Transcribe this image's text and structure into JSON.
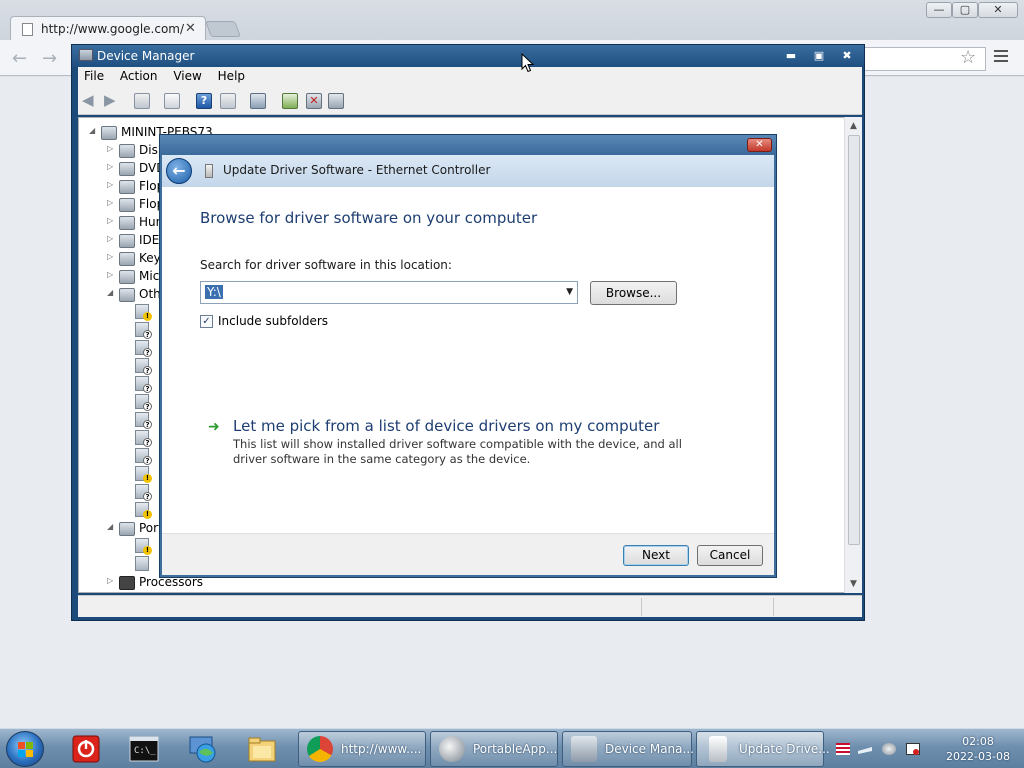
{
  "browser": {
    "tab_title": "http://www.google.com/",
    "tab_close": "✕",
    "controls": {
      "minimize": "—",
      "maximize": "▢",
      "close": "✕"
    },
    "back": "←",
    "forward": "→",
    "star": "☆"
  },
  "device_manager": {
    "title": "Device Manager",
    "controls": {
      "minimize": "▬",
      "maximize": "▣",
      "close": "✖"
    },
    "menu": [
      "File",
      "Action",
      "View",
      "Help"
    ],
    "tree": {
      "root": "MININT-PEBS73",
      "categories": [
        "Disk",
        "DVD",
        "Flop",
        "Flop",
        "Hun",
        "IDE",
        "Key",
        "Mic",
        "Oth"
      ],
      "ports_label": "Port",
      "processors_label": "Processors"
    }
  },
  "dialog": {
    "close": "✕",
    "back": "←",
    "header_title": "Update Driver Software - Ethernet Controller",
    "heading": "Browse for driver software on your computer",
    "search_label": "Search for driver software in this location:",
    "path_value": "Y:\\",
    "browse_label": "Browse...",
    "include_subfolders_label": "Include subfolders",
    "include_subfolders_checked": "✓",
    "pick_arrow": "➜",
    "pick_link": "Let me pick from a list of device drivers on my computer",
    "pick_description": "This list will show installed driver software compatible with the device, and all driver software in the same category as the device.",
    "next_label": "Next",
    "cancel_label": "Cancel"
  },
  "taskbar": {
    "tasks": [
      {
        "label": "http://www...."
      },
      {
        "label": "PortableApp..."
      },
      {
        "label": "Device Mana..."
      },
      {
        "label": "Update Drive..."
      }
    ],
    "clock_time": "02:08",
    "clock_date": "2022-03-08"
  },
  "colors": {
    "dialog_heading": "#1e3e72",
    "link_green_arrow": "#2d9b2d",
    "taskbar": "#6f8fae",
    "selection": "#3a6fb0"
  }
}
